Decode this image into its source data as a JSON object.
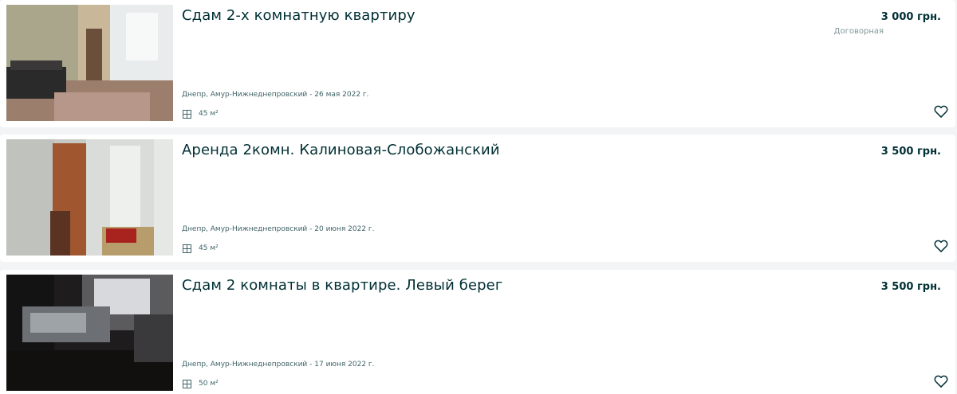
{
  "listings": [
    {
      "title": "Сдам 2-х комнатную квартиру",
      "price": "3 000 грн.",
      "price_note": "Договорная",
      "location_date": "Днепр, Амур-Нижнеднепровский - 26 мая 2022 г.",
      "area": "45 м²",
      "area_icon": "floor-plan-icon",
      "favorite_icon": "heart-outline-icon"
    },
    {
      "title": "Аренда 2комн. Калиновая-Слобожанский",
      "price": "3 500 грн.",
      "location_date": "Днепр, Амур-Нижнеднепровский - 20 июня 2022 г.",
      "area": "45 м²",
      "area_icon": "floor-plan-icon",
      "favorite_icon": "heart-outline-icon"
    },
    {
      "title": "Сдам 2 комнаты в квартире. Левый берег",
      "price": "3 500 грн.",
      "location_date": "Днепр, Амур-Нижнеднепровский - 17 июня 2022 г.",
      "area": "50 м²",
      "area_icon": "floor-plan-icon",
      "favorite_icon": "heart-outline-icon"
    }
  ],
  "colors": {
    "page_background": "#f2f4f5",
    "card_background": "#ffffff",
    "title_text": "#002f34",
    "secondary_text": "#406367",
    "muted_text": "#7f9799"
  }
}
